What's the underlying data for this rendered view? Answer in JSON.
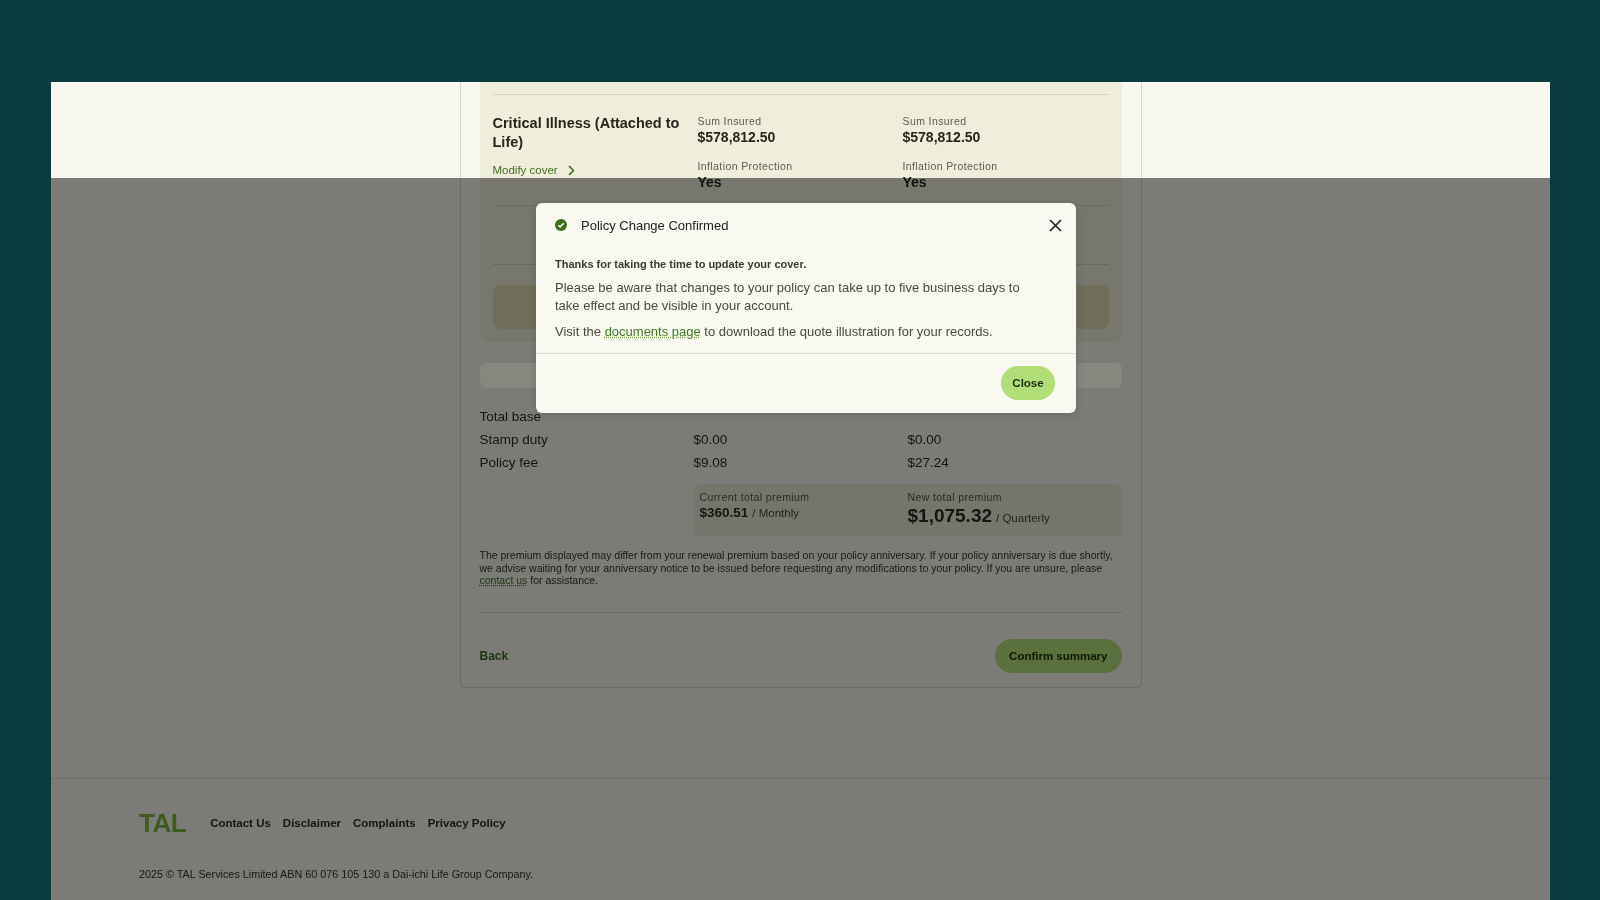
{
  "cover_panel": {
    "covers": [
      {
        "name": "Critical Illness (Attached to Life)",
        "action": "Modify cover",
        "columns": [
          {
            "fields": [
              {
                "label": "Sum Insured",
                "value": "$578,812.50"
              },
              {
                "label": "Inflation Protection",
                "value": "Yes"
              }
            ]
          },
          {
            "fields": [
              {
                "label": "Sum Insured",
                "value": "$578,812.50"
              },
              {
                "label": "Inflation Protection",
                "value": "Yes"
              }
            ]
          }
        ]
      }
    ]
  },
  "premium_table": {
    "rows": [
      {
        "label": "Total base"
      },
      {
        "label": "Stamp duty",
        "current": "$0.00",
        "new": "$0.00"
      },
      {
        "label": "Policy fee",
        "current": "$9.08",
        "new": "$27.24"
      }
    ]
  },
  "premium_summary": [
    {
      "label": "Current total premium",
      "amount": "$360.51",
      "frequency": "/ Monthly",
      "kind": "current"
    },
    {
      "label": "New total premium",
      "amount": "$1,075.32",
      "frequency": "/ Quarterly",
      "kind": "new"
    }
  ],
  "disclaimer": {
    "before": "The premium displayed may differ from your renewal premium based on your policy anniversary. If your policy anniversary is due shortly, we advise waiting for your anniversary notice to be issued before requesting any modifications to your policy. If you are unsure, please",
    "link": "contact us",
    "after": "for assistance."
  },
  "actions": {
    "back": "Back",
    "confirm": "Confirm summary"
  },
  "footer": {
    "logo": "TAL",
    "links": [
      "Contact Us",
      "Disclaimer",
      "Complaints",
      "Privacy Policy"
    ],
    "copyright": "2025 © TAL Services Limited ABN 60 076 105 130 a Dai-ichi Life Group Company."
  },
  "modal": {
    "title": "Policy Change Confirmed",
    "intro": "Thanks for taking the time to update your cover.",
    "message": "Please be aware that changes to your policy can take up to five business days to take effect and be visible in your account.",
    "visit": {
      "before": "Visit the",
      "link": "documents page",
      "after": "to download the quote illustration for your records."
    },
    "close_button": "Close"
  }
}
